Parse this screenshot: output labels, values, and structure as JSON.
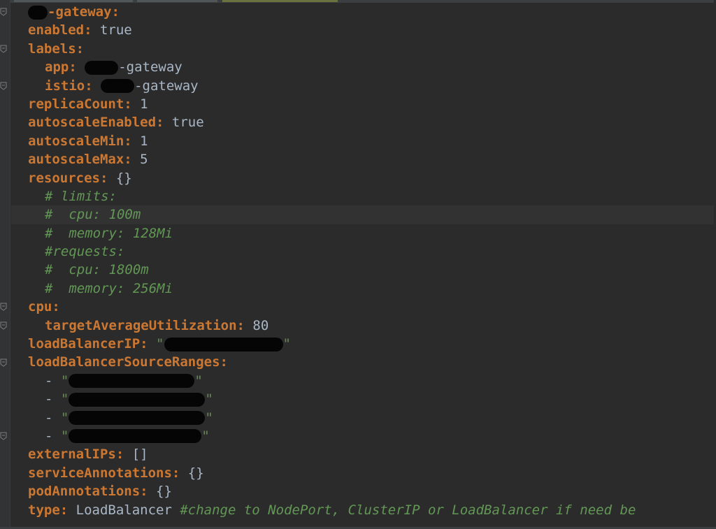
{
  "editor": {
    "lines": [
      {
        "indent": 0,
        "tokens": [
          {
            "c": "key",
            "t": "-gateway:",
            "redact_before": true
          }
        ]
      },
      {
        "indent": 1,
        "tokens": [
          {
            "c": "key",
            "t": "enabled:"
          },
          {
            "c": "val",
            "t": " true"
          }
        ]
      },
      {
        "indent": 1,
        "tokens": [
          {
            "c": "key",
            "t": "labels:"
          }
        ]
      },
      {
        "indent": 2,
        "tokens": [
          {
            "c": "key",
            "t": "app:"
          },
          {
            "c": "val",
            "t": " "
          },
          {
            "c": "val",
            "t": "-gateway",
            "redact_before": true
          }
        ]
      },
      {
        "indent": 2,
        "tokens": [
          {
            "c": "key",
            "t": "istio:"
          },
          {
            "c": "val",
            "t": " "
          },
          {
            "c": "val",
            "t": "-gateway",
            "redact_before": true
          }
        ]
      },
      {
        "indent": 1,
        "tokens": [
          {
            "c": "key",
            "t": "replicaCount:"
          },
          {
            "c": "val",
            "t": " 1"
          }
        ]
      },
      {
        "indent": 1,
        "tokens": [
          {
            "c": "key",
            "t": "autoscaleEnabled:"
          },
          {
            "c": "val",
            "t": " true"
          }
        ]
      },
      {
        "indent": 1,
        "tokens": [
          {
            "c": "key",
            "t": "autoscaleMin:"
          },
          {
            "c": "val",
            "t": " 1"
          }
        ]
      },
      {
        "indent": 1,
        "tokens": [
          {
            "c": "key",
            "t": "autoscaleMax:"
          },
          {
            "c": "val",
            "t": " 5"
          }
        ]
      },
      {
        "indent": 1,
        "tokens": [
          {
            "c": "key",
            "t": "resources:"
          },
          {
            "c": "val",
            "t": " {}"
          }
        ]
      },
      {
        "indent": 2,
        "tokens": [
          {
            "c": "cmt",
            "t": "# limits:"
          }
        ]
      },
      {
        "indent": 2,
        "current": true,
        "tokens": [
          {
            "c": "cmt",
            "t": "#  cpu: 100m"
          }
        ]
      },
      {
        "indent": 2,
        "tokens": [
          {
            "c": "cmt",
            "t": "#  memory: 128Mi"
          }
        ]
      },
      {
        "indent": 2,
        "tokens": [
          {
            "c": "cmt",
            "t": "#requests:"
          }
        ]
      },
      {
        "indent": 2,
        "tokens": [
          {
            "c": "cmt",
            "t": "#  cpu: 1800m"
          }
        ]
      },
      {
        "indent": 2,
        "tokens": [
          {
            "c": "cmt",
            "t": "#  memory: 256Mi"
          }
        ]
      },
      {
        "indent": 1,
        "tokens": [
          {
            "c": "key",
            "t": "cpu:"
          }
        ]
      },
      {
        "indent": 2,
        "tokens": [
          {
            "c": "key",
            "t": "targetAverageUtilization:"
          },
          {
            "c": "val",
            "t": " 80"
          }
        ]
      },
      {
        "indent": 1,
        "tokens": [
          {
            "c": "key",
            "t": "loadBalancerIP:"
          },
          {
            "c": "val",
            "t": " "
          },
          {
            "c": "str",
            "t": "\"",
            "redact_after": 170
          },
          {
            "c": "str",
            "t": "\""
          }
        ]
      },
      {
        "indent": 1,
        "tokens": [
          {
            "c": "key",
            "t": "loadBalancerSourceRanges:"
          }
        ]
      },
      {
        "indent": 2,
        "tokens": [
          {
            "c": "val",
            "t": "- "
          },
          {
            "c": "str",
            "t": "\"",
            "redact_after": 180
          },
          {
            "c": "str",
            "t": "\""
          }
        ]
      },
      {
        "indent": 2,
        "tokens": [
          {
            "c": "val",
            "t": "- "
          },
          {
            "c": "str",
            "t": "\"",
            "redact_after": 195
          },
          {
            "c": "str",
            "t": "\""
          }
        ]
      },
      {
        "indent": 2,
        "tokens": [
          {
            "c": "val",
            "t": "- "
          },
          {
            "c": "str",
            "t": "\"",
            "redact_after": 195
          },
          {
            "c": "str",
            "t": "\""
          }
        ]
      },
      {
        "indent": 2,
        "tokens": [
          {
            "c": "val",
            "t": "- "
          },
          {
            "c": "str",
            "t": "\"",
            "redact_after": 190
          },
          {
            "c": "str",
            "t": "\""
          }
        ]
      },
      {
        "indent": 1,
        "tokens": [
          {
            "c": "key",
            "t": "externalIPs:"
          },
          {
            "c": "val",
            "t": " []"
          }
        ]
      },
      {
        "indent": 1,
        "tokens": [
          {
            "c": "key",
            "t": "serviceAnnotations:"
          },
          {
            "c": "val",
            "t": " {}"
          }
        ]
      },
      {
        "indent": 1,
        "tokens": [
          {
            "c": "key",
            "t": "podAnnotations:"
          },
          {
            "c": "val",
            "t": " {}"
          }
        ]
      },
      {
        "indent": 1,
        "tokens": [
          {
            "c": "key",
            "t": "type:"
          },
          {
            "c": "val",
            "t": " LoadBalancer "
          },
          {
            "c": "cmt",
            "t": "#change to NodePort, ClusterIP or LoadBalancer if need be"
          }
        ]
      }
    ]
  },
  "colors": {
    "background": "#2b2b2b",
    "key": "#cc7832",
    "comment": "#629755",
    "text": "#a9b7c6"
  },
  "icons": {
    "fold_marker": "fold-marker-icon"
  }
}
